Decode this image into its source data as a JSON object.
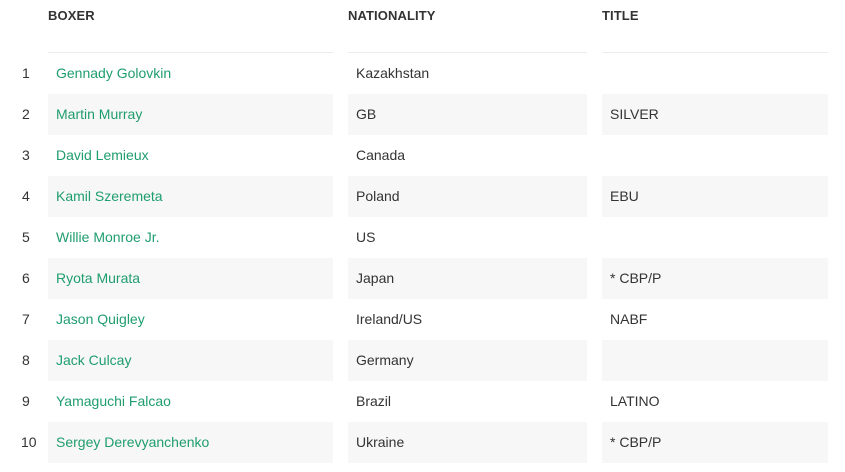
{
  "table": {
    "headers": {
      "boxer": "BOXER",
      "nationality": "NATIONALITY",
      "title": "TITLE"
    },
    "rows": [
      {
        "rank": "1",
        "boxer": "Gennady Golovkin",
        "nationality": "Kazakhstan",
        "title": ""
      },
      {
        "rank": "2",
        "boxer": "Martin Murray",
        "nationality": "GB",
        "title": "SILVER"
      },
      {
        "rank": "3",
        "boxer": "David Lemieux",
        "nationality": "Canada",
        "title": ""
      },
      {
        "rank": "4",
        "boxer": "Kamil Szeremeta",
        "nationality": "Poland",
        "title": "EBU"
      },
      {
        "rank": "5",
        "boxer": "Willie Monroe Jr.",
        "nationality": "US",
        "title": ""
      },
      {
        "rank": "6",
        "boxer": "Ryota Murata",
        "nationality": "Japan",
        "title": "* CBP/P"
      },
      {
        "rank": "7",
        "boxer": "Jason Quigley",
        "nationality": "Ireland/US",
        "title": "NABF"
      },
      {
        "rank": "8",
        "boxer": "Jack Culcay",
        "nationality": "Germany",
        "title": ""
      },
      {
        "rank": "9",
        "boxer": "Yamaguchi Falcao",
        "nationality": "Brazil",
        "title": "LATINO"
      },
      {
        "rank": "10",
        "boxer": "Sergey Derevyanchenko",
        "nationality": "Ukraine",
        "title": "* CBP/P"
      }
    ]
  },
  "colors": {
    "link": "#1f9d6f",
    "text": "#333333",
    "row_shade": "#f7f7f7",
    "header_rule": "#ececec"
  }
}
